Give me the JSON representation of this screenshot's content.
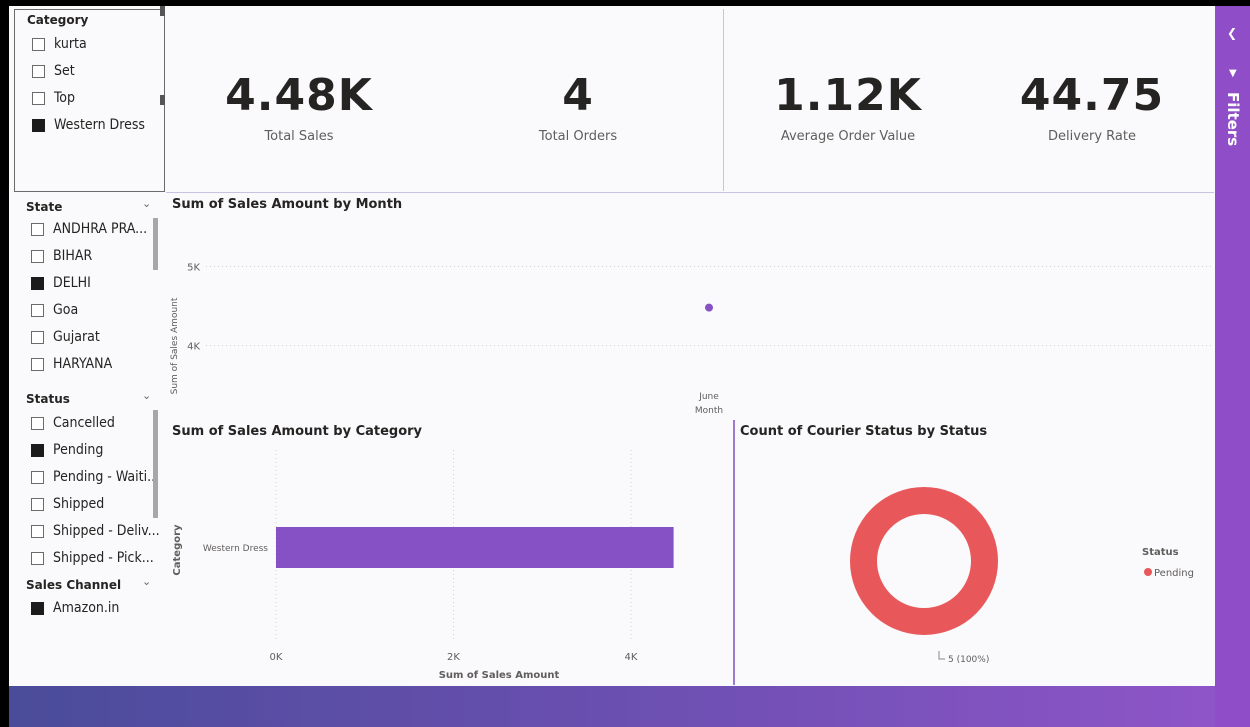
{
  "filters_pane": {
    "label": "Filters",
    "collapse_icon": "chevron-left-icon",
    "funnel_icon": "funnel-icon"
  },
  "slicers": {
    "category": {
      "title": "Category",
      "items": [
        {
          "label": "kurta",
          "checked": false
        },
        {
          "label": "Set",
          "checked": false
        },
        {
          "label": "Top",
          "checked": false
        },
        {
          "label": "Western Dress",
          "checked": true
        }
      ]
    },
    "state": {
      "title": "State",
      "items": [
        {
          "label": "ANDHRA PRA...",
          "checked": false
        },
        {
          "label": "BIHAR",
          "checked": false
        },
        {
          "label": "DELHI",
          "checked": true
        },
        {
          "label": "Goa",
          "checked": false
        },
        {
          "label": "Gujarat",
          "checked": false
        },
        {
          "label": "HARYANA",
          "checked": false
        }
      ]
    },
    "status": {
      "title": "Status",
      "items": [
        {
          "label": "Cancelled",
          "checked": false
        },
        {
          "label": "Pending",
          "checked": true
        },
        {
          "label": "Pending - Waiti...",
          "checked": false
        },
        {
          "label": "Shipped",
          "checked": false
        },
        {
          "label": "Shipped - Deliv...",
          "checked": false
        },
        {
          "label": "Shipped - Pick...",
          "checked": false
        }
      ]
    },
    "sales_channel": {
      "title": "Sales Channel",
      "items": [
        {
          "label": "Amazon.in",
          "checked": true
        }
      ]
    }
  },
  "kpis": [
    {
      "value": "4.48K",
      "label": "Total Sales"
    },
    {
      "value": "4",
      "label": "Total Orders"
    },
    {
      "value": "1.12K",
      "label": "Average Order Value"
    },
    {
      "value": "44.75",
      "label": "Delivery Rate"
    }
  ],
  "colors": {
    "accent": "#8f4ec7",
    "bar": "#8551c4",
    "donut": "#e8585a",
    "dot": "#8551c4"
  },
  "chart_data": [
    {
      "type": "scatter",
      "title": "Sum of Sales Amount by Month",
      "xlabel": "Month",
      "ylabel": "Sum of Sales Amount",
      "categories": [
        "June"
      ],
      "values": [
        4480
      ],
      "yticks": [
        "5K",
        "4K"
      ],
      "ylim": [
        3500,
        5500
      ],
      "grid": true
    },
    {
      "type": "bar",
      "title": "Sum of Sales Amount by Category",
      "xlabel": "Sum of Sales Amount",
      "ylabel": "Category",
      "categories": [
        "Western Dress"
      ],
      "values": [
        4480
      ],
      "xticks": [
        "0K",
        "2K",
        "4K"
      ],
      "xlim": [
        0,
        4800
      ],
      "grid": true
    },
    {
      "type": "pie",
      "title": "Count of Courier Status by Status",
      "legend_title": "Status",
      "legend_position": "right",
      "series": [
        {
          "name": "Pending",
          "values": [
            5
          ]
        }
      ],
      "data_label": "5 (100%)"
    }
  ]
}
